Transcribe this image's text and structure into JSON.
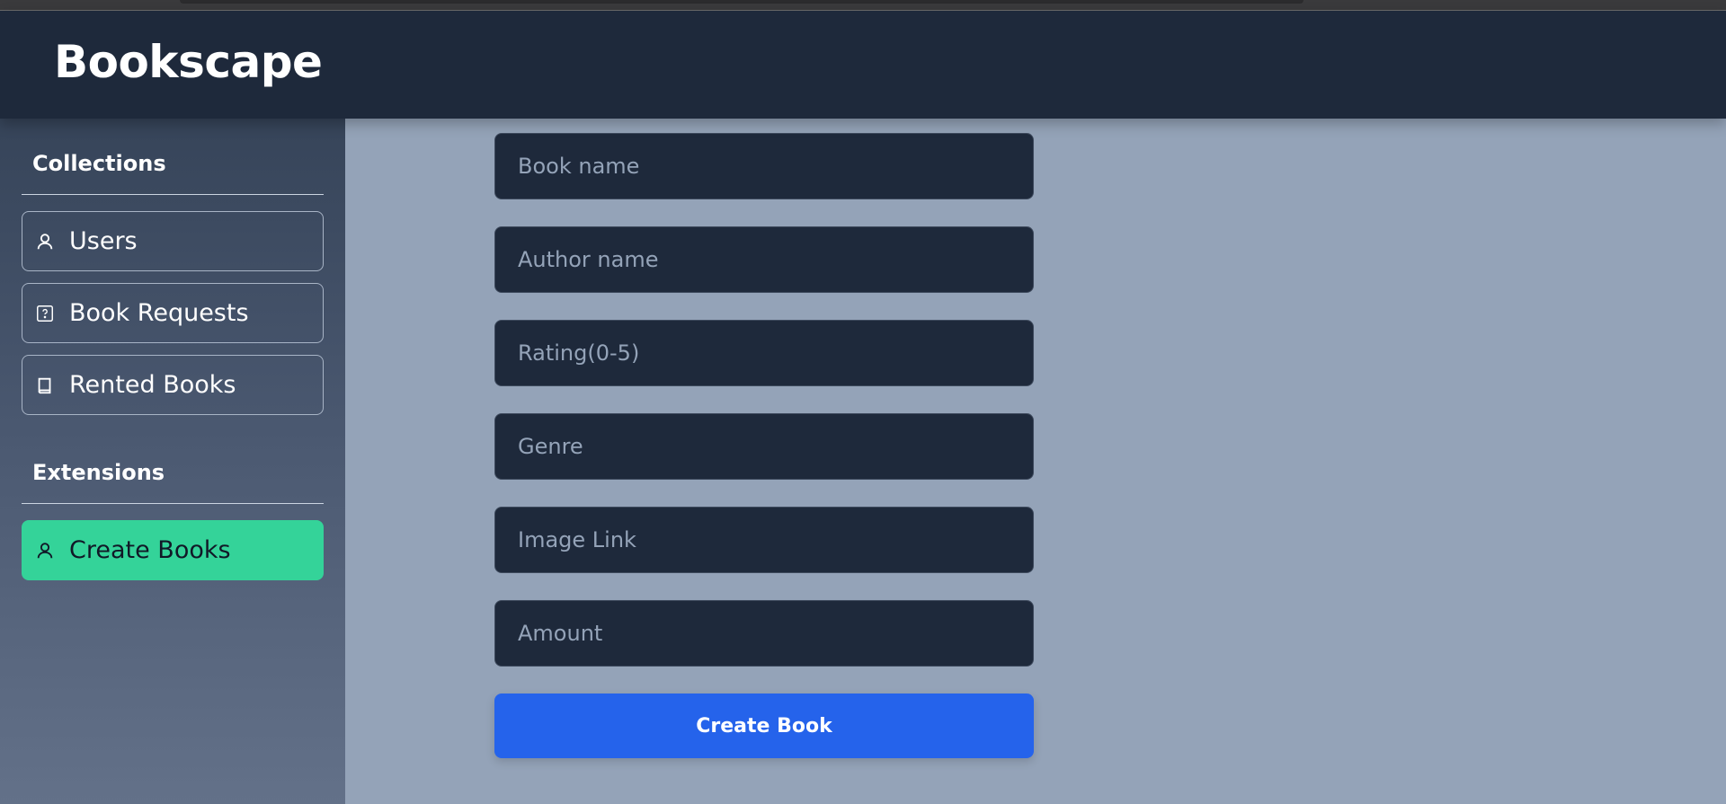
{
  "app": {
    "title": "Bookscape"
  },
  "sidebar": {
    "sections": [
      {
        "title": "Collections",
        "items": [
          {
            "label": "Users",
            "icon": "user-icon"
          },
          {
            "label": "Book Requests",
            "icon": "question-square-icon"
          },
          {
            "label": "Rented Books",
            "icon": "book-icon"
          }
        ]
      },
      {
        "title": "Extensions",
        "items": [
          {
            "label": "Create Books",
            "icon": "user-icon",
            "active": true
          }
        ]
      }
    ]
  },
  "form": {
    "fields": [
      {
        "placeholder": "Book name",
        "value": ""
      },
      {
        "placeholder": "Author name",
        "value": ""
      },
      {
        "placeholder": "Rating(0-5)",
        "value": ""
      },
      {
        "placeholder": "Genre",
        "value": ""
      },
      {
        "placeholder": "Image Link",
        "value": ""
      },
      {
        "placeholder": "Amount",
        "value": ""
      }
    ],
    "submit_label": "Create Book"
  },
  "colors": {
    "header_bg": "#1e293b",
    "active_item": "#34d399",
    "primary_button": "#2563eb",
    "main_bg": "#94a3b8"
  }
}
